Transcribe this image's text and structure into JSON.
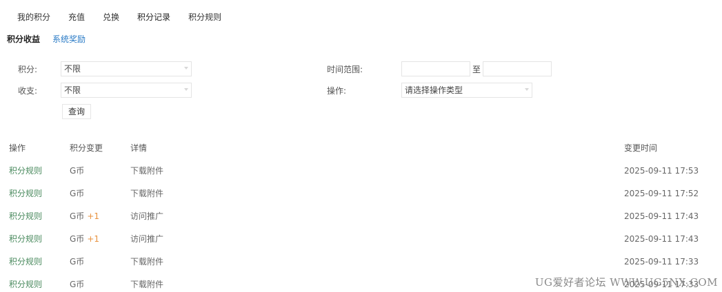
{
  "top_tabs": [
    "我的积分",
    "充值",
    "兑换",
    "积分记录",
    "积分规则"
  ],
  "sub_tabs": {
    "active": "积分收益",
    "other": "系统奖励"
  },
  "filters": {
    "points_label": "积分:",
    "points_value": "不限",
    "io_label": "收支:",
    "io_value": "不限",
    "time_label": "时间范围:",
    "to_text": "至",
    "op_label": "操作:",
    "op_value": "请选择操作类型",
    "query_button": "查询"
  },
  "table": {
    "headers": [
      "操作",
      "积分变更",
      "详情",
      "变更时间"
    ],
    "rows": [
      {
        "op": "积分规则",
        "currency": "G币",
        "amount": "",
        "detail": "下载附件",
        "time": "2025-09-11 17:53"
      },
      {
        "op": "积分规则",
        "currency": "G币",
        "amount": "",
        "detail": "下载附件",
        "time": "2025-09-11 17:52"
      },
      {
        "op": "积分规则",
        "currency": "G币",
        "amount": "+1",
        "detail": "访问推广",
        "time": "2025-09-11 17:43"
      },
      {
        "op": "积分规则",
        "currency": "G币",
        "amount": "+1",
        "detail": "访问推广",
        "time": "2025-09-11 17:43"
      },
      {
        "op": "积分规则",
        "currency": "G币",
        "amount": "",
        "detail": "下载附件",
        "time": "2025-09-11 17:33"
      },
      {
        "op": "积分规则",
        "currency": "G币",
        "amount": "",
        "detail": "下载附件",
        "time": "2025-09-11 17:33"
      }
    ]
  },
  "watermark": "UG爱好者论坛 WWW.UG5NX.COM",
  "colors": {
    "link_blue": "#2a7bc6",
    "op_green": "#4a8a5e",
    "amount_orange": "#e8913e"
  }
}
